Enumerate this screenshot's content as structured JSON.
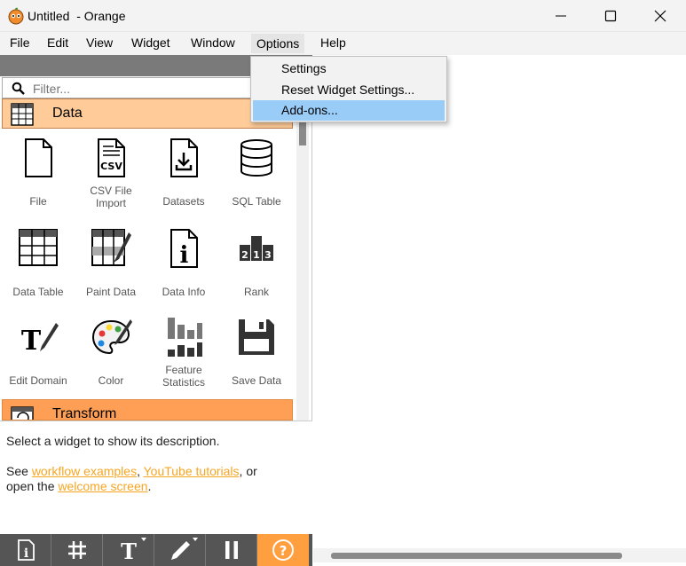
{
  "window": {
    "title": "Untitled  - Orange"
  },
  "menubar": {
    "items": [
      "File",
      "Edit",
      "View",
      "Widget",
      "Window",
      "Options",
      "Help"
    ]
  },
  "options_menu": {
    "items": [
      "Settings",
      "Reset Widget Settings...",
      "Add-ons..."
    ],
    "highlighted": "Add-ons..."
  },
  "filter": {
    "placeholder": "Filter..."
  },
  "categories": {
    "data": {
      "label": "Data",
      "color": "#ffcc99"
    },
    "transform": {
      "label": "Transform",
      "color": "#ff9f55"
    }
  },
  "widgets": [
    {
      "label": "File",
      "icon": "file-icon"
    },
    {
      "label": "CSV File Import",
      "icon": "csv-file-icon"
    },
    {
      "label": "Datasets",
      "icon": "datasets-icon"
    },
    {
      "label": "SQL Table",
      "icon": "database-icon"
    },
    {
      "label": "Data Table",
      "icon": "table-icon"
    },
    {
      "label": "Paint Data",
      "icon": "paint-data-icon"
    },
    {
      "label": "Data Info",
      "icon": "info-icon"
    },
    {
      "label": "Rank",
      "icon": "rank-icon"
    },
    {
      "label": "Edit Domain",
      "icon": "edit-domain-icon"
    },
    {
      "label": "Color",
      "icon": "palette-icon"
    },
    {
      "label": "Feature Statistics",
      "icon": "feature-statistics-icon"
    },
    {
      "label": "Save Data",
      "icon": "floppy-icon"
    }
  ],
  "description": {
    "text": "Select a widget to show its description.",
    "see": "See",
    "link1": "workflow examples",
    "comma": ",",
    "link2": "YouTube tutorials",
    "or": ", or",
    "open": "open the",
    "link3": "welcome screen",
    "period": "."
  },
  "toolbar": {
    "buttons": [
      "info-icon",
      "grid-icon",
      "text-icon",
      "pen-icon",
      "pause-icon",
      "help-icon"
    ]
  },
  "colors": {
    "accent": "#ff9f40",
    "link": "#f6a623",
    "highlight": "#99ccf7"
  }
}
